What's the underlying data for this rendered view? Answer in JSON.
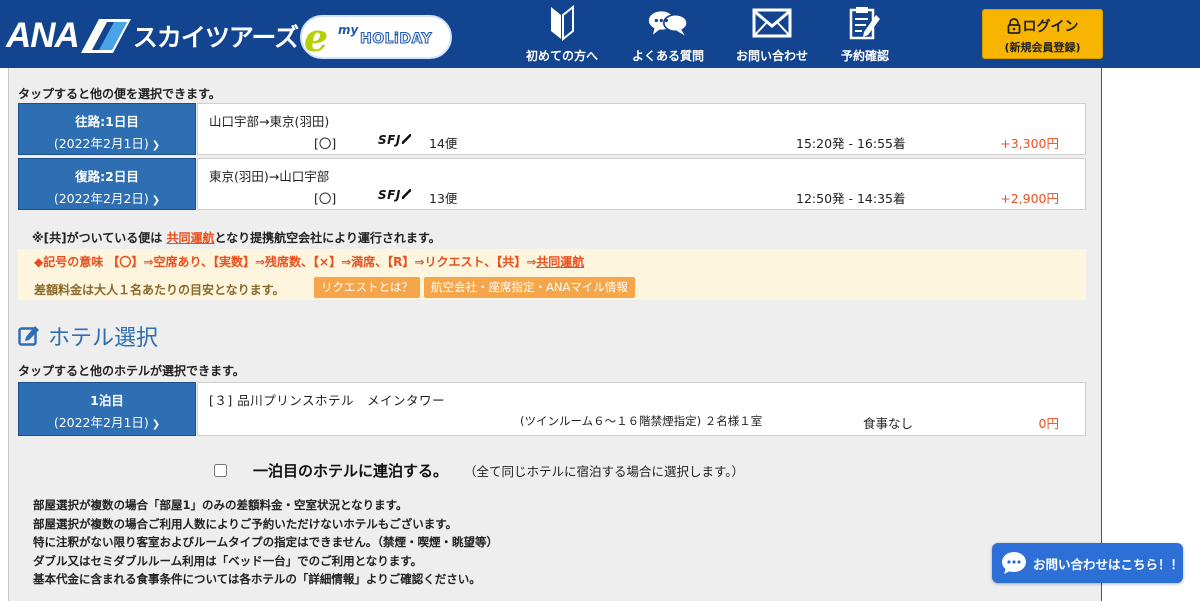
{
  "header": {
    "brand_ana": "ANA",
    "brand_jp": "スカイツアーズ",
    "brand_holiday_e": "e",
    "brand_holiday_my": "my",
    "brand_holiday_word": "HOLiDAY",
    "nav": [
      {
        "label": "初めての方へ",
        "icon": "beginner-mark-icon"
      },
      {
        "label": "よくある質問",
        "icon": "chat-bubbles-icon"
      },
      {
        "label": "お問い合わせ",
        "icon": "envelope-icon"
      },
      {
        "label": "予約確認",
        "icon": "clipboard-pen-icon"
      }
    ],
    "login": {
      "label": "ログイン",
      "sub": "(新規会員登録)"
    }
  },
  "flights": {
    "tap_note": "タップすると他の便を選択できます。",
    "legs": [
      {
        "label": "往路:1日目",
        "date": "(2022年2月1日)",
        "route": "山口宇部→東京(羽田)",
        "availability": "[〇]",
        "airline": "SFJ",
        "flight": "14便",
        "time": "15:20発 - 16:55着",
        "price": "+3,300円"
      },
      {
        "label": "復路:2日目",
        "date": "(2022年2月2日)",
        "route": "東京(羽田)→山口宇部",
        "availability": "[〇]",
        "airline": "SFJ",
        "flight": "13便",
        "time": "12:50発 - 14:35着",
        "price": "+2,900円"
      }
    ],
    "codeshare_note_pre": "※[共]がついている便は ",
    "codeshare_link": "共同運航",
    "codeshare_note_post": "となり提携航空会社により運行されます。",
    "legend_symbols": "◆記号の意味 【〇】⇒空席あり、【実数】⇒残席数、【×】⇒満席、【R】⇒リクエスト、【共】⇒",
    "legend_link": "共同運航",
    "diff_note": "差額料金は大人１名あたりの目安となります。",
    "pill_request": "リクエストとは？",
    "pill_airline": "航空会社・座席指定・ANAマイル情報"
  },
  "hotel": {
    "section_title": "ホテル選択",
    "tap_note": "タップすると他のホテルが選択できます。",
    "night_label": "1泊目",
    "night_date": "(2022年2月1日)",
    "name": "[３] 品川プリンスホテル　メインタワー",
    "room": "(ツインルーム６～１６階禁煙指定) ２名様１室",
    "meal": "食事なし",
    "price": "0円",
    "consecutive_label": "一泊目のホテルに連泊する。",
    "consecutive_sub": "（全て同じホテルに宿泊する場合に選択します。）",
    "notes": [
      "部屋選択が複数の場合「部屋1」のみの差額料金・空室状況となります。",
      "部屋選択が複数の場合ご利用人数によりご予約いただけないホテルもございます。",
      "特に注釈がない限り客室およびルームタイプの指定はできません。（禁煙・喫煙・眺望等）",
      "ダブル又はセミダブルルーム利用は「ベッド一台」でのご利用となります。",
      "基本代金に含まれる食事条件については各ホテルの「詳細情報」よりご確認ください。"
    ]
  },
  "chat": {
    "label": "お問い合わせはこちら！！"
  },
  "colors": {
    "header": "#13448f",
    "leg_label": "#2e6eb2",
    "price": "#e8501f",
    "login": "#f7b500",
    "legend_bg": "#fdf5dd",
    "pill": "#f5a64a",
    "chat": "#2c6fd6"
  }
}
